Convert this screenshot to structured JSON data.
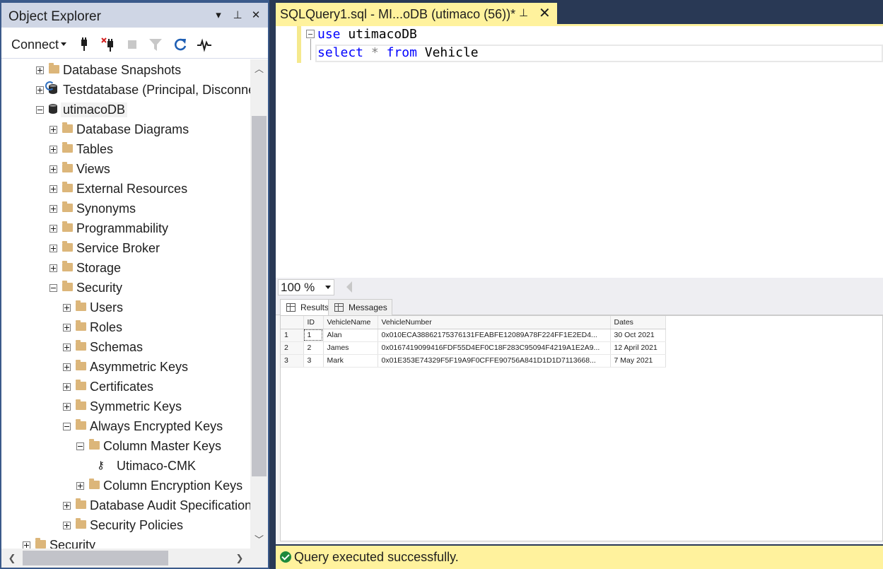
{
  "object_explorer": {
    "title": "Object Explorer",
    "title_buttons": {
      "dropdown": "▾",
      "pin": "⊥",
      "close": "✕"
    },
    "toolbar": {
      "connect_label": "Connect"
    },
    "tree": [
      {
        "label": "Database Snapshots",
        "expander": "plus",
        "icon": "folder-icon",
        "level": 0
      },
      {
        "label": "Testdatabase (Principal, Disconnected)",
        "expander": "plus",
        "icon": "database-sync-icon",
        "level": 0
      },
      {
        "label": "utimacoDB",
        "expander": "minus",
        "icon": "database-icon",
        "level": 0,
        "selected": true
      },
      {
        "label": "Database Diagrams",
        "expander": "plus",
        "icon": "folder-icon",
        "level": 1
      },
      {
        "label": "Tables",
        "expander": "plus",
        "icon": "folder-icon",
        "level": 1
      },
      {
        "label": "Views",
        "expander": "plus",
        "icon": "folder-icon",
        "level": 1
      },
      {
        "label": "External Resources",
        "expander": "plus",
        "icon": "folder-icon",
        "level": 1
      },
      {
        "label": "Synonyms",
        "expander": "plus",
        "icon": "folder-icon",
        "level": 1
      },
      {
        "label": "Programmability",
        "expander": "plus",
        "icon": "folder-icon",
        "level": 1
      },
      {
        "label": "Service Broker",
        "expander": "plus",
        "icon": "folder-icon",
        "level": 1
      },
      {
        "label": "Storage",
        "expander": "plus",
        "icon": "folder-icon",
        "level": 1
      },
      {
        "label": "Security",
        "expander": "minus",
        "icon": "folder-icon",
        "level": 1
      },
      {
        "label": "Users",
        "expander": "plus",
        "icon": "folder-icon",
        "level": 2
      },
      {
        "label": "Roles",
        "expander": "plus",
        "icon": "folder-icon",
        "level": 2
      },
      {
        "label": "Schemas",
        "expander": "plus",
        "icon": "folder-icon",
        "level": 2
      },
      {
        "label": "Asymmetric Keys",
        "expander": "plus",
        "icon": "folder-icon",
        "level": 2
      },
      {
        "label": "Certificates",
        "expander": "plus",
        "icon": "folder-icon",
        "level": 2
      },
      {
        "label": "Symmetric Keys",
        "expander": "plus",
        "icon": "folder-icon",
        "level": 2
      },
      {
        "label": "Always Encrypted Keys",
        "expander": "minus",
        "icon": "folder-icon",
        "level": 2
      },
      {
        "label": "Column Master Keys",
        "expander": "minus",
        "icon": "folder-icon",
        "level": 3
      },
      {
        "label": "Utimaco-CMK",
        "expander": "none",
        "icon": "key-icon",
        "level": 4
      },
      {
        "label": "Column Encryption Keys",
        "expander": "plus",
        "icon": "folder-icon",
        "level": 3
      },
      {
        "label": "Database Audit Specifications",
        "expander": "plus",
        "icon": "folder-icon",
        "level": 2
      },
      {
        "label": "Security Policies",
        "expander": "plus",
        "icon": "folder-icon",
        "level": 2
      },
      {
        "label": "Security",
        "expander": "plus",
        "icon": "folder-icon",
        "level": -1
      }
    ]
  },
  "query_tab": {
    "title": "SQLQuery1.sql - MI...oDB (utimaco (56))*",
    "pin": "⊥",
    "close": "✕"
  },
  "editor": {
    "lines": [
      [
        {
          "t": "use",
          "c": "kw"
        },
        {
          "t": " utimacoDB",
          "c": "id"
        }
      ],
      [
        {
          "t": "select",
          "c": "kw"
        },
        {
          "t": " ",
          "c": "id"
        },
        {
          "t": "*",
          "c": "op"
        },
        {
          "t": " ",
          "c": "id"
        },
        {
          "t": "from",
          "c": "kw"
        },
        {
          "t": " Vehicle",
          "c": "id"
        }
      ]
    ]
  },
  "zoom": {
    "value": "100 %"
  },
  "results": {
    "tabs": [
      {
        "label": "Results",
        "active": true
      },
      {
        "label": "Messages",
        "active": false
      }
    ],
    "columns": [
      "ID",
      "VehicleName",
      "VehicleNumber",
      "Dates"
    ],
    "rows": [
      {
        "n": "1",
        "cells": [
          "1",
          "Alan",
          "0x010ECA38862175376131FEABFE12089A78F224FF1E2ED4...",
          "30 Oct 2021"
        ]
      },
      {
        "n": "2",
        "cells": [
          "2",
          "James",
          "0x0167419099416FDF55D4EF0C18F283C95094F4219A1E2A9...",
          "12 April 2021"
        ]
      },
      {
        "n": "3",
        "cells": [
          "3",
          "Mark",
          "0x01E353E74329F5F19A9F0CFFE90756A841D1D1D7113668...",
          "7 May 2021"
        ]
      }
    ]
  },
  "status": {
    "message": "Query executed successfully."
  },
  "colors": {
    "chrome": "#293955",
    "tab_active": "#fff29d",
    "keyword": "#0000ff",
    "folder": "#dcb67a"
  }
}
